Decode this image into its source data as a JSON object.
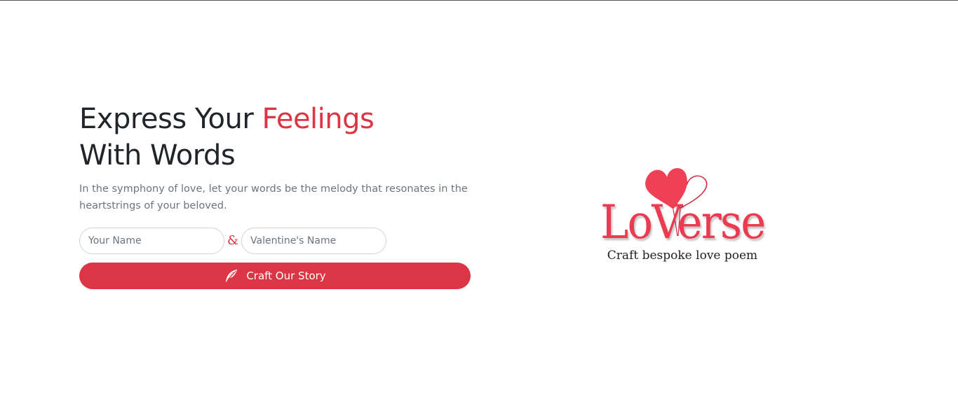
{
  "hero": {
    "headline_part1": "Express Your ",
    "headline_accent": "Feelings",
    "headline_part2": "With Words",
    "subtext": "In the symphony of love, let your words be the melody that resonates in the heartstrings of your beloved."
  },
  "form": {
    "your_name_placeholder": "Your Name",
    "your_name_value": "",
    "ampersand": "&",
    "valentine_name_placeholder": "Valentine's Name",
    "valentine_name_value": "",
    "submit_label": "Craft Our Story",
    "submit_icon": "feather-icon"
  },
  "logo": {
    "wordmark": "LoVerse",
    "tagline": "Craft bespoke love poem",
    "icon": "hearts-icon"
  },
  "colors": {
    "accent": "#dc3545",
    "logo_red": "#ec3b50",
    "heading": "#212529",
    "muted": "#6c757d"
  }
}
